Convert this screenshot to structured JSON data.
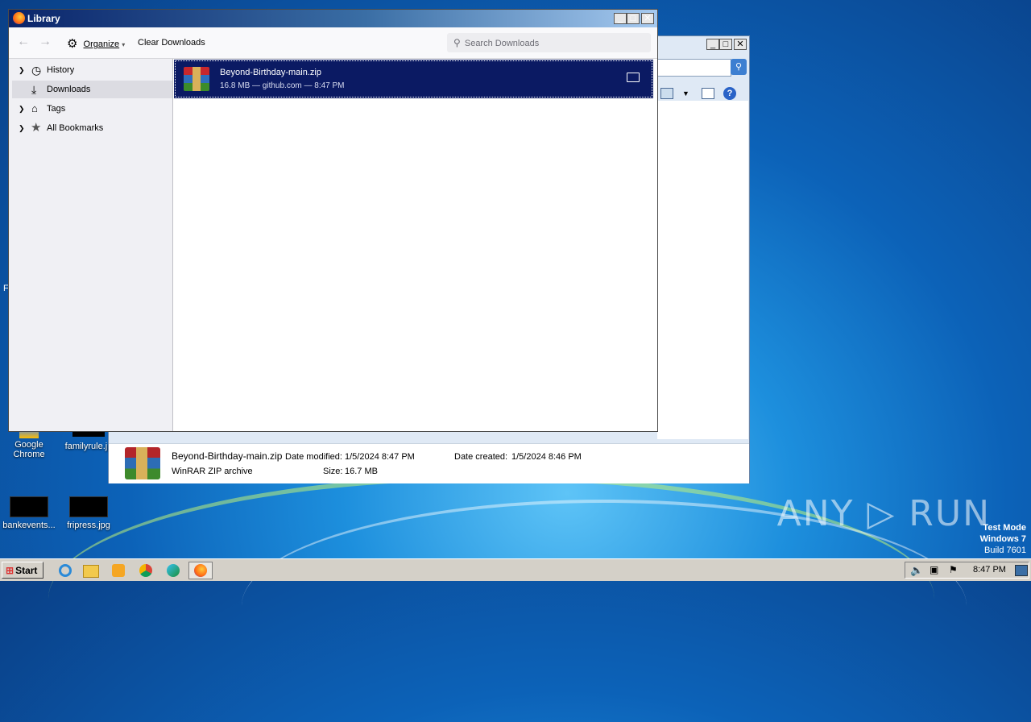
{
  "desktop": {
    "icons": [
      {
        "label": "Google Chrome"
      },
      {
        "label": "familyrule.jp"
      },
      {
        "label": "bankevents..."
      },
      {
        "label": "fripress.jpg"
      }
    ],
    "edge_letter": "F",
    "watermark": "ANY ▷ RUN",
    "test_mode": {
      "line1": "Test Mode",
      "line2": "Windows 7",
      "line3": "Build 7601"
    }
  },
  "explorer": {
    "file_name": "Beyond-Birthday-main.zip",
    "file_type": "WinRAR ZIP archive",
    "date_modified_label": "Date modified:",
    "date_modified": "1/5/2024 8:47 PM",
    "date_created_label": "Date created:",
    "date_created": "1/5/2024 8:46 PM",
    "size_label": "Size:",
    "size": "16.7 MB"
  },
  "library": {
    "title": "Library",
    "toolbar": {
      "organize": "Organize",
      "clear_downloads": "Clear Downloads",
      "search_placeholder": "Search Downloads"
    },
    "sidebar": [
      {
        "label": "History",
        "icon": "clock-icon",
        "expandable": true
      },
      {
        "label": "Downloads",
        "icon": "download-icon",
        "expandable": false,
        "selected": true
      },
      {
        "label": "Tags",
        "icon": "tag-icon",
        "expandable": true
      },
      {
        "label": "All Bookmarks",
        "icon": "star-icon",
        "expandable": true
      }
    ],
    "download": {
      "name": "Beyond-Birthday-main.zip",
      "details": "16.8 MB — github.com — 8:47 PM"
    }
  },
  "taskbar": {
    "start": "Start",
    "clock": "8:47 PM"
  },
  "colors": {
    "selection": "#0b1a63",
    "title_bar_start": "#0a246a",
    "title_bar_end": "#a6caf0",
    "taskbar": "#d4d0c8"
  }
}
